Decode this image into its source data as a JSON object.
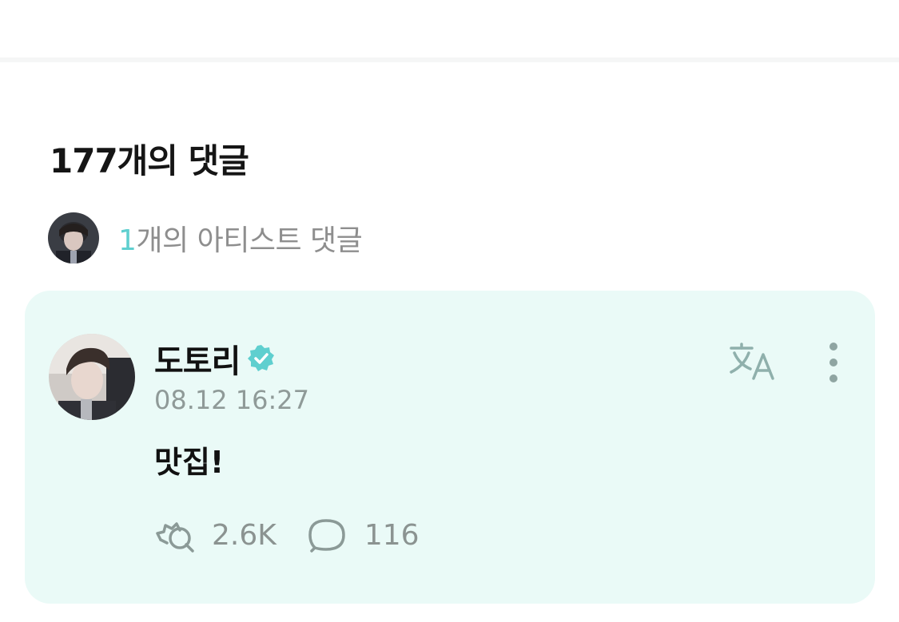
{
  "comments": {
    "title": "177개의 댓글",
    "artist_summary": {
      "count": "1",
      "label": "개의 아티스트 댓글"
    }
  },
  "comment": {
    "author": "도토리",
    "timestamp": "08.12 16:27",
    "body": "맛집!",
    "likes": "2.6K",
    "replies": "116"
  },
  "colors": {
    "accent": "#5fcfcf",
    "card_background": "#eafaf7"
  },
  "icons": {
    "verified": "verified-badge-icon",
    "translate": "translate-icon",
    "more": "more-vertical-icon",
    "like": "cheer-icon",
    "reply": "speech-bubble-icon"
  }
}
